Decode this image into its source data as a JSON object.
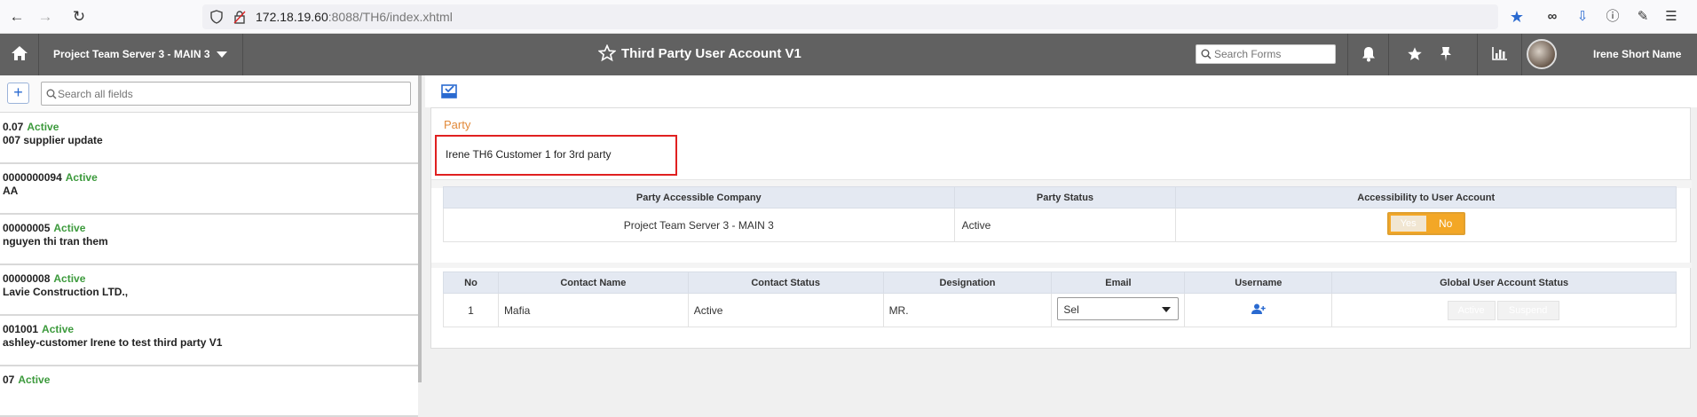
{
  "browser": {
    "url_host": "172.18.19.60",
    "url_rest": ":8088/TH6/index.xhtml"
  },
  "header": {
    "project": "Project Team Server 3 - MAIN 3",
    "title": "Third Party User Account V1",
    "search_placeholder": "Search Forms",
    "user_name": "Irene Short Name"
  },
  "sidebar": {
    "search_placeholder": "Search all fields",
    "add_label": "+",
    "items": [
      {
        "code": "0.07",
        "status": "Active",
        "name": "007 supplier update"
      },
      {
        "code": "0000000094",
        "status": "Active",
        "name": "AA"
      },
      {
        "code": "00000005",
        "status": "Active",
        "name": "nguyen thi tran them"
      },
      {
        "code": "00000008",
        "status": "Active",
        "name": "Lavie Construction LTD.,"
      },
      {
        "code": "001001",
        "status": "Active",
        "name": "ashley-customer Irene to test third party V1"
      },
      {
        "code": "07",
        "status": "Active",
        "name": ""
      }
    ]
  },
  "form": {
    "party_label": "Party",
    "party_value": "Irene TH6 Customer 1 for 3rd party",
    "company_table": {
      "headers": [
        "Party Accessible Company",
        "Party Status",
        "Accessibility to User Account"
      ],
      "row": {
        "company": "Project Team Server 3 - MAIN 3",
        "status": "Active",
        "yes": "Yes",
        "no": "No"
      }
    },
    "contact_table": {
      "headers": [
        "No",
        "Contact Name",
        "Contact Status",
        "Designation",
        "Email",
        "Username",
        "Global User Account Status"
      ],
      "row": {
        "no": "1",
        "name": "Mafia",
        "status": "Active",
        "designation": "MR.",
        "email": "Sel",
        "active_btn": "Active",
        "suspend_btn": "Suspend"
      }
    }
  },
  "colors": {
    "header_bg": "#616161",
    "accent_orange": "#f3a726",
    "status_green": "#3c9a3c",
    "highlight_red": "#e02020"
  }
}
